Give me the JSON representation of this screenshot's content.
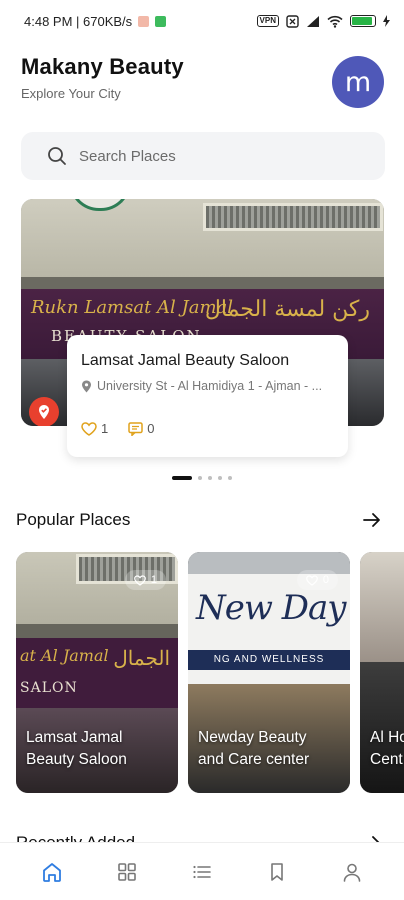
{
  "status_bar": {
    "time_speed": "4:48 PM | 670KB/s",
    "vpn_label": "VPN",
    "battery_level": 0.9
  },
  "header": {
    "title": "Makany Beauty",
    "subtitle": "Explore Your City",
    "avatar_letter": "m"
  },
  "search": {
    "placeholder": "Search Places"
  },
  "featured": {
    "sign_latin": "Rukn Lamsat Al Jamal",
    "sign_arabic": "ركن لمسة الجمال",
    "sign_sub": "BEAUTY SALON",
    "title": "Lamsat Jamal Beauty Saloon",
    "address": "University St - Al Hamidiya 1 - Ajman - ...",
    "likes": "1",
    "comments": "0",
    "carousel_total": 5,
    "carousel_active": 0
  },
  "popular": {
    "title": "Popular Places",
    "places": [
      {
        "name_line1": "Lamsat Jamal",
        "name_line2": "Beauty Saloon",
        "likes": "1",
        "sign_latin": "at Al Jamal",
        "sign_arabic": "الجمال",
        "sign_sub": "SALON"
      },
      {
        "name_line1": "Newday Beauty",
        "name_line2": "and Care center",
        "likes": "0",
        "sign_latin": "New Day",
        "sign_sub": "NG AND WELLNESS"
      },
      {
        "name_line1": "Al Ho",
        "name_line2": "Cent"
      }
    ]
  },
  "recent": {
    "title": "Recently Added"
  },
  "nav": {
    "items": [
      "home",
      "categories",
      "list",
      "saved",
      "profile"
    ],
    "active": "home"
  },
  "colors": {
    "accent": "#4f58b8",
    "nav_active": "#2f7de1",
    "stat_icon": "#e0a21c"
  }
}
